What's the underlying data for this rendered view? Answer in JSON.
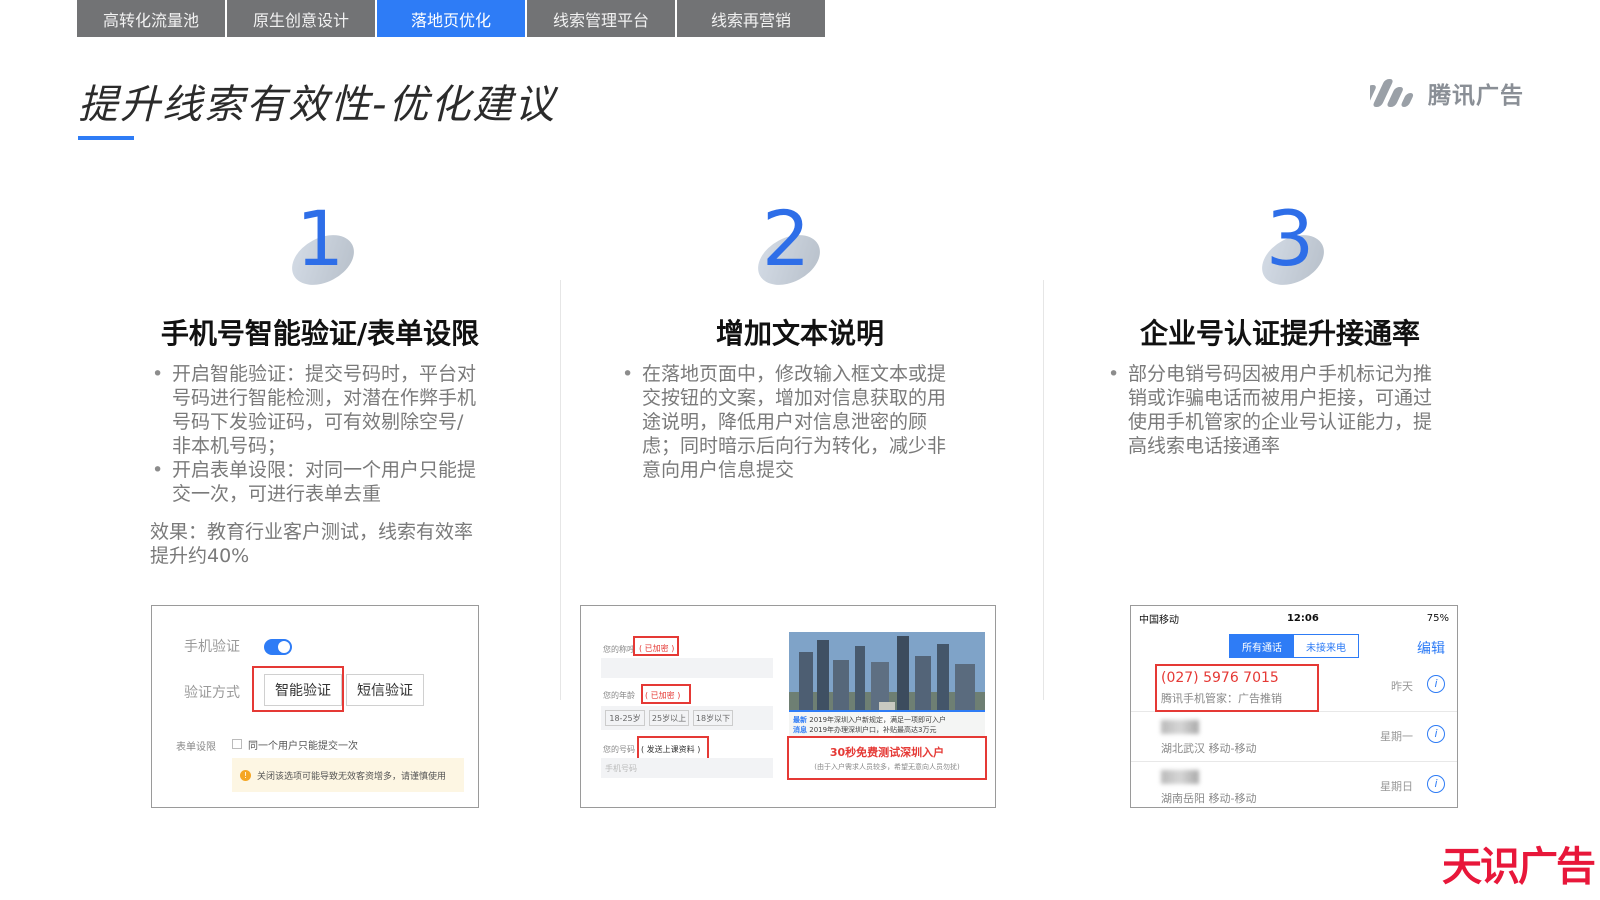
{
  "tabs": [
    {
      "label": "高转化流量池",
      "active": false
    },
    {
      "label": "原生创意设计",
      "active": false
    },
    {
      "label": "落地页优化",
      "active": true
    },
    {
      "label": "线索管理平台",
      "active": false
    },
    {
      "label": "线索再营销",
      "active": false
    }
  ],
  "page_title": "提升线索有效性-优化建议",
  "logo_text": "腾讯广告",
  "brand_watermark": "天识广告",
  "accent_color": "#2e7cf6",
  "columns": [
    {
      "number": "1",
      "title": "手机号智能验证/表单设限",
      "bullets": [
        "开启智能验证：提交号码时，平台对号码进行智能检测，对潜在作弊手机号码下发验证码，可有效剔除空号/非本机号码；",
        "开启表单设限：对同一个用户只能提交一次，可进行表单去重"
      ],
      "effect": "效果：教育行业客户测试，线索有效率提升约40%",
      "screenshot": {
        "phone_verify_label": "手机验证",
        "verify_method_label": "验证方式",
        "smart_verify": "智能验证",
        "sms_verify": "短信验证",
        "form_limit_label": "表单设限",
        "form_limit_option": "同一个用户只能提交一次",
        "warning": "关闭该选项可能导致无效客资增多，请谨慎使用"
      }
    },
    {
      "number": "2",
      "title": "增加文本说明",
      "bullets": [
        "在落地页面中，修改输入框文本或提交按钮的文案，增加对信息获取的用途说明，降低用户对信息泄密的顾虑；同时暗示后向行为转化，减少非意向用户信息提交"
      ],
      "screenshot": {
        "field1_label": "您的称呼",
        "field1_tag": "( 已加密 )",
        "field2_label": "您的年龄",
        "field2_tag": "( 已加密 )",
        "age_options": [
          "18-25岁",
          "25岁以上",
          "18岁以下"
        ],
        "field3_label": "您的号码",
        "field3_tag": "( 发送上课资料 )",
        "field3_placeholder": "手机号码",
        "news_line1": "2019年深圳入户新规定，满足一项即可入户",
        "news_line2": "2019年办理深圳户口，补贴最高达3万元",
        "news_tag1": "最新",
        "news_tag2": "消息",
        "cta_main": "30秒免费测试深圳入户",
        "cta_sub": "(由于入户需求人员较多，希望无意向人员勿扰)"
      }
    },
    {
      "number": "3",
      "title": "企业号认证提升接通率",
      "bullets": [
        "部分电销号码因被用户手机标记为推销或诈骗电话而被用户拒接，可通过使用手机管家的企业号认证能力，提高线索电话接通率"
      ],
      "screenshot": {
        "carrier": "中国移动",
        "time": "12:06",
        "battery": "75%",
        "seg_all": "所有通话",
        "seg_missed": "未接来电",
        "edit": "编辑",
        "calls": [
          {
            "number": "(027) 5976 7015",
            "sub": "腾讯手机管家：广告推销",
            "day": "昨天"
          },
          {
            "number": "",
            "sub": "湖北武汉 移动-移动",
            "day": "星期一"
          },
          {
            "number": "",
            "sub": "湖南岳阳 移动-移动",
            "day": "星期日"
          }
        ]
      }
    }
  ]
}
